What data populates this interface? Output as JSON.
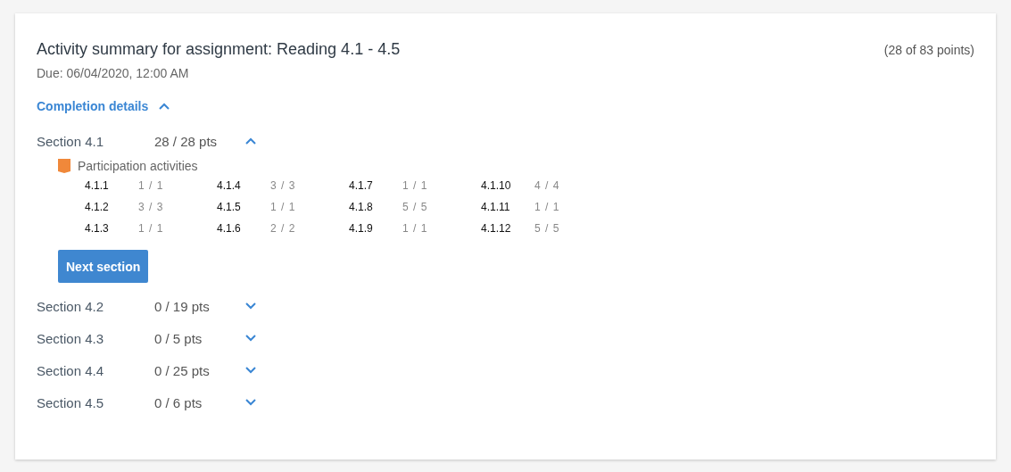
{
  "summary": {
    "title": "Activity summary for assignment: Reading 4.1 - 4.5",
    "due": "Due: 06/04/2020, 12:00 AM",
    "points": "(28 of 83 points)",
    "completion": {
      "label": "Completion details",
      "expanded": true
    },
    "sections": [
      {
        "name": "Section 4.1",
        "score": "28 / 28 pts",
        "expanded": true,
        "groups": [
          {
            "label": "Participation activities",
            "color": "#f0883a",
            "activities": [
              {
                "id": "4.1.1",
                "score": "1 / 1"
              },
              {
                "id": "4.1.2",
                "score": "3 / 3"
              },
              {
                "id": "4.1.3",
                "score": "1 / 1"
              },
              {
                "id": "4.1.4",
                "score": "3 / 3"
              },
              {
                "id": "4.1.5",
                "score": "1 / 1"
              },
              {
                "id": "4.1.6",
                "score": "2 / 2"
              },
              {
                "id": "4.1.7",
                "score": "1 / 1"
              },
              {
                "id": "4.1.8",
                "score": "5 / 5"
              },
              {
                "id": "4.1.9",
                "score": "1 / 1"
              },
              {
                "id": "4.1.10",
                "score": "4 / 4"
              },
              {
                "id": "4.1.11",
                "score": "1 / 1"
              },
              {
                "id": "4.1.12",
                "score": "5 / 5"
              }
            ]
          }
        ],
        "button": "Next section"
      },
      {
        "name": "Section 4.2",
        "score": "0 / 19 pts",
        "expanded": false
      },
      {
        "name": "Section 4.3",
        "score": "0 / 5 pts",
        "expanded": false
      },
      {
        "name": "Section 4.4",
        "score": "0 / 25 pts",
        "expanded": false
      },
      {
        "name": "Section 4.5",
        "score": "0 / 6 pts",
        "expanded": false
      }
    ]
  }
}
